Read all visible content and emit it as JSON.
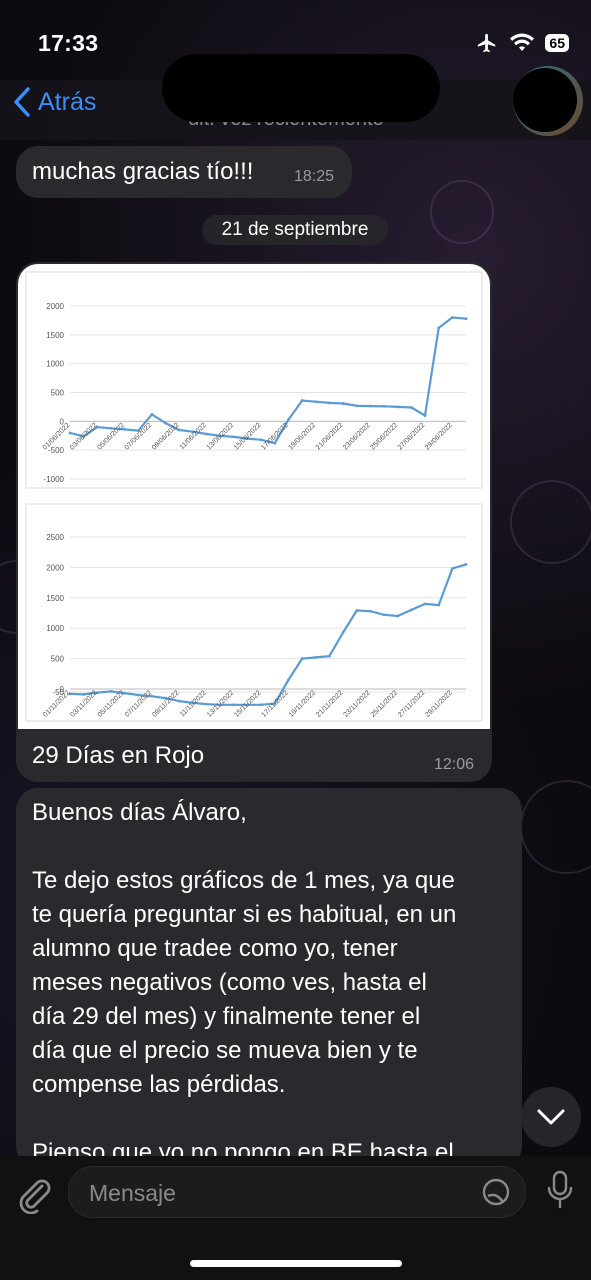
{
  "status_bar": {
    "time": "17:33",
    "battery": "65"
  },
  "header": {
    "back_label": "Atrás",
    "subtitle": "últ. vez recientemente"
  },
  "messages": {
    "m1": {
      "text": "muchas gracias tío!!!",
      "time": "18:25"
    },
    "date_separator": "21 de septiembre",
    "m2": {
      "caption": "29 Días en Rojo",
      "time": "12:06"
    },
    "m3": {
      "lines": [
        "Buenos días Álvaro,",
        "",
        "Te dejo estos gráficos de 1 mes, ya que",
        "te quería preguntar si es habitual, en un",
        "alumno que tradee como yo, tener",
        "meses negativos (como ves, hasta el",
        "día 29 del mes) y finalmente tener el",
        "día que el precio se mueva bien y te",
        "compense las pérdidas.",
        "",
        "Pienso que yo no pongo en BE hasta el"
      ]
    }
  },
  "composer": {
    "placeholder": "Mensaje"
  },
  "colors": {
    "accent": "#3a8ef6",
    "line": "#5b9bd5"
  },
  "chart_data": [
    {
      "type": "line",
      "ylim": [
        -1000,
        2000
      ],
      "yticks": [
        2000,
        1500,
        1000,
        500,
        0,
        -500,
        -1000
      ],
      "x": [
        "01/06/2022",
        "02/06/2022",
        "03/06/2022",
        "04/06/2022",
        "05/06/2022",
        "06/06/2022",
        "07/06/2022",
        "08/06/2022",
        "09/06/2022",
        "10/06/2022",
        "11/06/2022",
        "12/06/2022",
        "13/06/2022",
        "14/06/2022",
        "15/06/2022",
        "16/06/2022",
        "17/06/2022",
        "18/06/2022",
        "19/06/2022",
        "20/06/2022",
        "21/06/2022",
        "22/06/2022",
        "23/06/2022",
        "24/06/2022",
        "25/06/2022",
        "26/06/2022",
        "27/06/2022",
        "28/06/2022",
        "29/06/2022",
        "30/06/2022"
      ],
      "x_tick_labels": [
        "01/06/2022",
        "03/06/2022",
        "05/06/2022",
        "07/06/2022",
        "09/06/2022",
        "11/06/2022",
        "13/06/2022",
        "15/06/2022",
        "17/06/2022",
        "19/06/2022",
        "21/06/2022",
        "23/06/2022",
        "25/06/2022",
        "27/06/2022",
        "29/06/2022"
      ],
      "values": [
        -200,
        -260,
        -100,
        -120,
        -140,
        -160,
        120,
        -30,
        -150,
        -180,
        -220,
        -250,
        -270,
        -300,
        -320,
        -380,
        30,
        360,
        340,
        320,
        310,
        270,
        265,
        260,
        250,
        240,
        100,
        1620,
        1800,
        1780
      ]
    },
    {
      "type": "line",
      "ylim": [
        -50,
        2500
      ],
      "yticks": [
        2500,
        2000,
        1500,
        1000,
        500,
        0,
        -50
      ],
      "x": [
        "01/11/2022",
        "02/11/2022",
        "03/11/2022",
        "04/11/2022",
        "05/11/2022",
        "06/11/2022",
        "07/11/2022",
        "08/11/2022",
        "09/11/2022",
        "10/11/2022",
        "11/11/2022",
        "12/11/2022",
        "13/11/2022",
        "14/11/2022",
        "15/11/2022",
        "16/11/2022",
        "17/11/2022",
        "18/11/2022",
        "19/11/2022",
        "20/11/2022",
        "21/11/2022",
        "22/11/2022",
        "23/11/2022",
        "24/11/2022",
        "25/11/2022",
        "26/11/2022",
        "27/11/2022",
        "28/11/2022",
        "29/11/2022",
        "30/11/2022"
      ],
      "x_tick_labels": [
        "01/11/2022",
        "03/11/2022",
        "05/11/2022",
        "07/11/2022",
        "09/11/2022",
        "11/11/2022",
        "13/11/2022",
        "15/11/2022",
        "17/11/2022",
        "19/11/2022",
        "21/11/2022",
        "23/11/2022",
        "25/11/2022",
        "27/11/2022",
        "29/11/2022"
      ],
      "values": [
        -80,
        -90,
        -60,
        -40,
        -70,
        -100,
        -120,
        -150,
        -200,
        -230,
        -250,
        -260,
        -260,
        -260,
        -260,
        -240,
        150,
        500,
        520,
        540,
        930,
        1290,
        1280,
        1220,
        1200,
        1300,
        1400,
        1380,
        1980,
        2050
      ]
    }
  ]
}
